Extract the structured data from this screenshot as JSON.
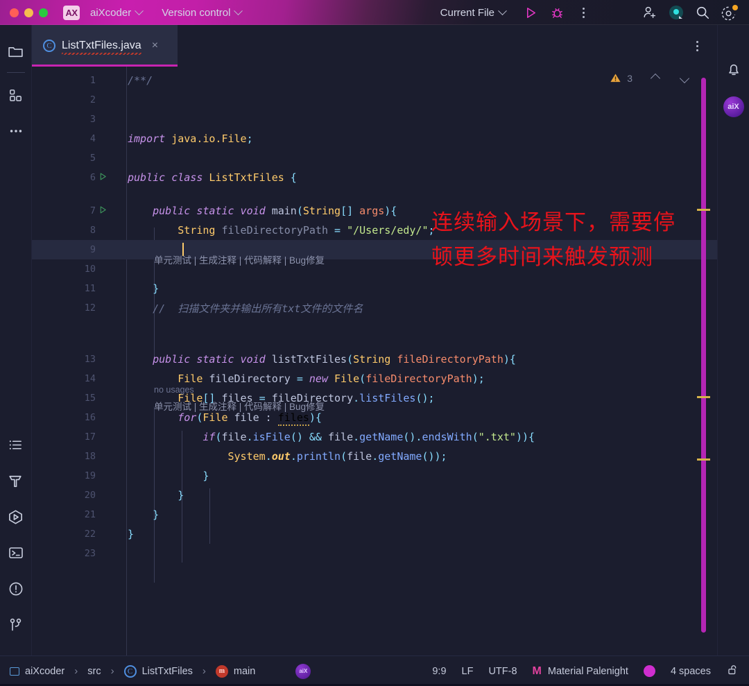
{
  "titlebar": {
    "traffic_lights": [
      "close",
      "minimize",
      "maximize"
    ],
    "app_badge": "AX",
    "project_name": "aiXcoder",
    "vcs_label": "Version control",
    "run_config": "Current File",
    "icons": [
      "run-icon",
      "debug-icon",
      "more-options-icon",
      "add-user-icon",
      "ai-assistant-icon",
      "search-icon",
      "settings-icon"
    ]
  },
  "tabs": {
    "active": {
      "label": "ListTxtFiles.java",
      "icon": "java-class-icon",
      "close": "×"
    },
    "more_label": "more-tab-actions"
  },
  "left_rail": {
    "items": [
      {
        "name": "project-icon",
        "label": "Project"
      },
      {
        "name": "structure-icon",
        "label": "Structure"
      },
      {
        "name": "more-tool-windows-icon",
        "label": "More tool windows"
      },
      {
        "name": "todo-icon",
        "label": "TODO"
      },
      {
        "name": "build-icon",
        "label": "Build"
      },
      {
        "name": "run-icon",
        "label": "Run"
      },
      {
        "name": "terminal-icon",
        "label": "Terminal"
      },
      {
        "name": "problems-icon",
        "label": "Problems"
      },
      {
        "name": "git-icon",
        "label": "Git"
      }
    ]
  },
  "right_rail": {
    "items": [
      {
        "name": "notifications-bell-icon",
        "label": "Notifications"
      },
      {
        "name": "aixcoder-badge",
        "label": "aiX"
      }
    ]
  },
  "editor": {
    "inspection": {
      "warning_icon": "warning-triangle-icon",
      "count": "3",
      "prev": "previous-problem",
      "next": "next-problem"
    },
    "caret_position": "9:9",
    "annotation": {
      "line1": "连续输入场景下，需要停",
      "line2": "顿更多时间来触发预测",
      "color": "#e8131b"
    },
    "inlay_actions": "单元测试 | 生成注释 | 代码解释 | Bug修复",
    "no_usages": "no usages",
    "lines": [
      {
        "no": "1",
        "tokens": [
          {
            "t": "/**/",
            "c": "cmt"
          }
        ]
      },
      {
        "no": "2",
        "tokens": []
      },
      {
        "no": "3",
        "tokens": []
      },
      {
        "no": "4",
        "tokens": [
          {
            "t": "import ",
            "c": "kw"
          },
          {
            "t": "java.io.File",
            "c": "type"
          },
          {
            "t": ";",
            "c": "punc"
          }
        ]
      },
      {
        "no": "5",
        "tokens": []
      },
      {
        "no": "6",
        "run": true,
        "tokens": [
          {
            "t": "public class ",
            "c": "kw"
          },
          {
            "t": "ListTxtFiles",
            "c": "type"
          },
          {
            "t": " {",
            "c": "punc"
          }
        ]
      },
      {
        "no": "7",
        "run": true,
        "tokens": [
          {
            "t": "    public static void ",
            "c": "kw"
          },
          {
            "t": "main",
            "c": "plain"
          },
          {
            "t": "(",
            "c": "punc"
          },
          {
            "t": "String",
            "c": "type"
          },
          {
            "t": "[] ",
            "c": "punc"
          },
          {
            "t": "args",
            "c": "param"
          },
          {
            "t": "){",
            "c": "punc"
          }
        ]
      },
      {
        "no": "8",
        "tokens": [
          {
            "t": "        ",
            "c": "plain"
          },
          {
            "t": "String",
            "c": "type"
          },
          {
            "t": " fileDirectoryPath ",
            "c": "dim"
          },
          {
            "t": "= ",
            "c": "punc"
          },
          {
            "t": "\"/Users/edy/\"",
            "c": "str"
          },
          {
            "t": ";",
            "c": "punc"
          }
        ]
      },
      {
        "no": "9",
        "highlight": true,
        "caret": true,
        "tokens": []
      },
      {
        "no": "10",
        "tokens": []
      },
      {
        "no": "11",
        "tokens": [
          {
            "t": "    }",
            "c": "punc"
          }
        ]
      },
      {
        "no": "12",
        "tokens": [
          {
            "t": "    //  扫描文件夹并输出所有txt文件的文件名",
            "c": "cmt"
          }
        ]
      },
      {
        "no": "13",
        "tokens": [
          {
            "t": "    public static void ",
            "c": "kw"
          },
          {
            "t": "listTxtFiles",
            "c": "plain"
          },
          {
            "t": "(",
            "c": "punc"
          },
          {
            "t": "String",
            "c": "type"
          },
          {
            "t": " fileDirectoryPath",
            "c": "param"
          },
          {
            "t": "){",
            "c": "punc"
          }
        ]
      },
      {
        "no": "14",
        "tokens": [
          {
            "t": "        ",
            "c": "plain"
          },
          {
            "t": "File",
            "c": "type"
          },
          {
            "t": " fileDirectory ",
            "c": "plain"
          },
          {
            "t": "= ",
            "c": "punc"
          },
          {
            "t": "new ",
            "c": "kw"
          },
          {
            "t": "File",
            "c": "type"
          },
          {
            "t": "(",
            "c": "punc"
          },
          {
            "t": "fileDirectoryPath",
            "c": "param"
          },
          {
            "t": ");",
            "c": "punc"
          }
        ]
      },
      {
        "no": "15",
        "tokens": [
          {
            "t": "        ",
            "c": "plain"
          },
          {
            "t": "File",
            "c": "type"
          },
          {
            "t": "[] ",
            "c": "punc"
          },
          {
            "t": "files ",
            "c": "plain"
          },
          {
            "t": "= ",
            "c": "punc"
          },
          {
            "t": "fileDirectory",
            "c": "plain"
          },
          {
            "t": ".",
            "c": "punc"
          },
          {
            "t": "listFiles",
            "c": "fn"
          },
          {
            "t": "();",
            "c": "punc"
          }
        ]
      },
      {
        "no": "16",
        "tokens": [
          {
            "t": "        for",
            "c": "kw"
          },
          {
            "t": "(",
            "c": "punc"
          },
          {
            "t": "File",
            "c": "type"
          },
          {
            "t": " file : ",
            "c": "plain"
          },
          {
            "t": "files",
            "c": "wavy"
          },
          {
            "t": "){",
            "c": "punc"
          }
        ]
      },
      {
        "no": "17",
        "tokens": [
          {
            "t": "            if",
            "c": "kw"
          },
          {
            "t": "(",
            "c": "punc"
          },
          {
            "t": "file",
            "c": "plain"
          },
          {
            "t": ".",
            "c": "punc"
          },
          {
            "t": "isFile",
            "c": "fn"
          },
          {
            "t": "() ",
            "c": "punc"
          },
          {
            "t": "&& ",
            "c": "punc"
          },
          {
            "t": "file",
            "c": "plain"
          },
          {
            "t": ".",
            "c": "punc"
          },
          {
            "t": "getName",
            "c": "fn"
          },
          {
            "t": "().",
            "c": "punc"
          },
          {
            "t": "endsWith",
            "c": "fn"
          },
          {
            "t": "(",
            "c": "punc"
          },
          {
            "t": "\".txt\"",
            "c": "str"
          },
          {
            "t": ")){",
            "c": "punc"
          }
        ]
      },
      {
        "no": "18",
        "tokens": [
          {
            "t": "                ",
            "c": "plain"
          },
          {
            "t": "System",
            "c": "type"
          },
          {
            "t": ".",
            "c": "punc"
          },
          {
            "t": "out",
            "c": "staticf"
          },
          {
            "t": ".",
            "c": "punc"
          },
          {
            "t": "println",
            "c": "fn"
          },
          {
            "t": "(",
            "c": "punc"
          },
          {
            "t": "file",
            "c": "plain"
          },
          {
            "t": ".",
            "c": "punc"
          },
          {
            "t": "getName",
            "c": "fn"
          },
          {
            "t": "());",
            "c": "punc"
          }
        ]
      },
      {
        "no": "19",
        "tokens": [
          {
            "t": "            }",
            "c": "punc"
          }
        ]
      },
      {
        "no": "20",
        "tokens": [
          {
            "t": "        }",
            "c": "punc"
          }
        ]
      },
      {
        "no": "21",
        "tokens": [
          {
            "t": "    }",
            "c": "punc"
          }
        ]
      },
      {
        "no": "22",
        "tokens": [
          {
            "t": "}",
            "c": "punc"
          }
        ]
      },
      {
        "no": "23",
        "tokens": []
      }
    ]
  },
  "statusbar": {
    "breadcrumb": [
      {
        "icon": "module-icon",
        "label": "aiXcoder"
      },
      {
        "icon": null,
        "label": "src"
      },
      {
        "icon": "java-class-icon",
        "label": "ListTxtFiles"
      },
      {
        "icon": "method-icon",
        "label": "main"
      }
    ],
    "separator": "›",
    "aix_badge": "aiX",
    "caret": "9:9",
    "line_separator": "LF",
    "encoding": "UTF-8",
    "theme_icon": "material-theme-icon",
    "theme": "Material Palenight",
    "color_dot": "#cf2ecf",
    "indent": "4 spaces",
    "lock_icon": "unlocked-padlock-icon"
  }
}
